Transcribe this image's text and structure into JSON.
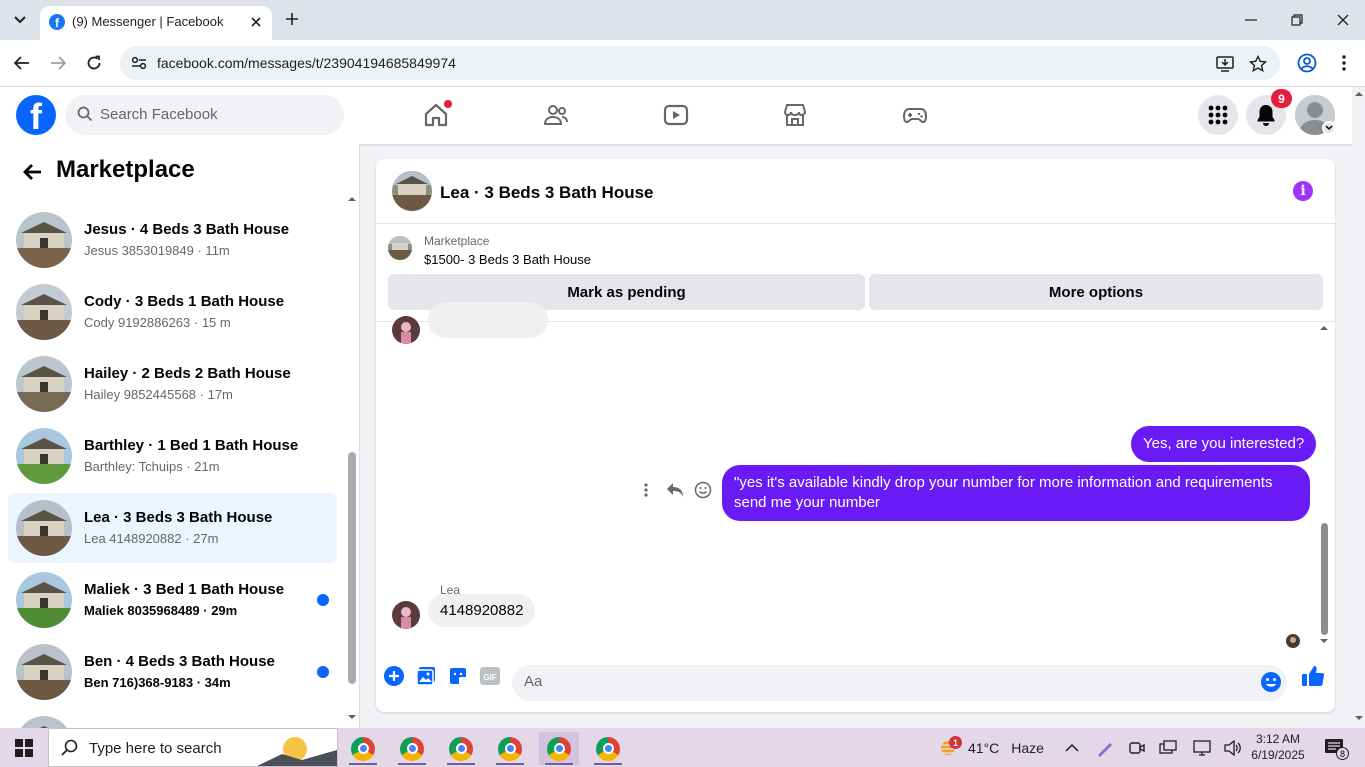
{
  "browser": {
    "tab_title": "(9) Messenger | Facebook",
    "url": "facebook.com/messages/t/23904194685849974"
  },
  "fb": {
    "search_placeholder": "Search Facebook",
    "notification_count": "9"
  },
  "sidebar": {
    "title": "Marketplace",
    "conversations": [
      {
        "name": "Jesus · 4 Beds 3 Bath House",
        "sub": "Jesus 3853019849 · 11m",
        "unread": false,
        "active": false
      },
      {
        "name": "Cody · 3 Beds 1 Bath House",
        "sub": "Cody 9192886263 · 15 m",
        "unread": false,
        "active": false
      },
      {
        "name": "Hailey · 2 Beds 2 Bath House",
        "sub": "Hailey 9852445568 · 17m",
        "unread": false,
        "active": false
      },
      {
        "name": "Barthley · 1 Bed 1 Bath House",
        "sub": "Barthley: Tchuips · 21m",
        "unread": false,
        "active": false
      },
      {
        "name": "Lea · 3 Beds 3 Bath House",
        "sub": "Lea 4148920882 · 27m",
        "unread": false,
        "active": true
      },
      {
        "name": "Maliek · 3 Bed 1 Bath House",
        "sub": "Maliek 8035968489 · 29m",
        "unread": true,
        "active": false
      },
      {
        "name": "Ben · 4 Beds 3 Bath House",
        "sub": "Ben 716)368-9183 · 34m",
        "unread": true,
        "active": false
      }
    ]
  },
  "chat": {
    "title": "Lea · 3 Beds 3 Bath House",
    "listing_tag": "Marketplace",
    "listing_title": "$1500- 3 Beds 3 Bath House",
    "mark_pending_label": "Mark as pending",
    "more_options_label": "More options",
    "messages": {
      "out_1": "Yes, are you interested?",
      "out_2": "\"yes it's available kindly drop your number for more information and requirements send me your number",
      "sender": "Lea",
      "in_1": "4148920882"
    },
    "composer_placeholder": "Aa"
  },
  "taskbar": {
    "search_placeholder": "Type here to search",
    "weather_temp": "41°C",
    "weather_desc": "Haze",
    "weather_badge": "1",
    "time": "3:12 AM",
    "date": "6/19/2025",
    "notif_count": "8"
  },
  "colors": {
    "fb_blue": "#0866ff",
    "bubble_out": "#6a1bf5",
    "active_row": "#ebf5ff",
    "notification_red": "#e41e3f"
  }
}
